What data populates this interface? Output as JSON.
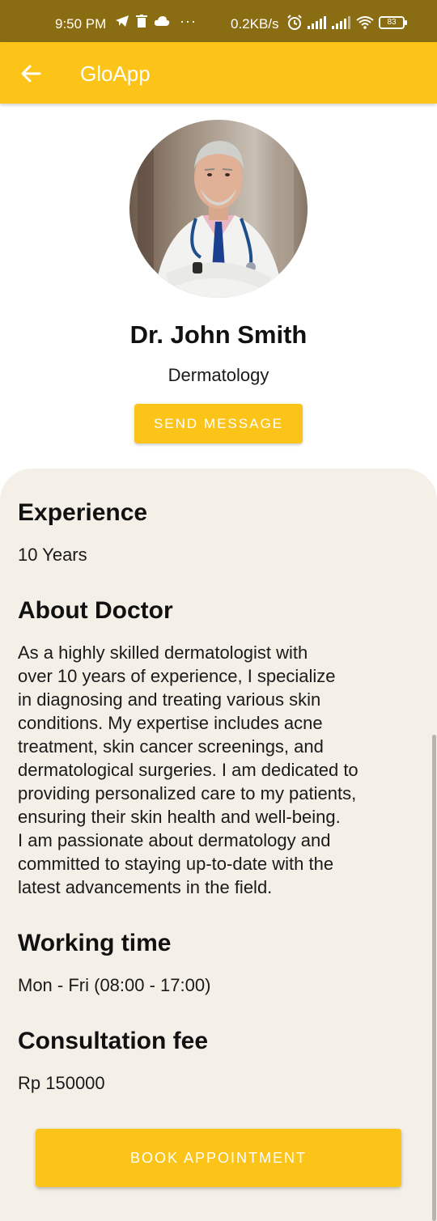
{
  "status_bar": {
    "time": "9:50 PM",
    "dots": "···",
    "net_speed": "0.2KB/s",
    "battery": "83",
    "icons": [
      "telegram-icon",
      "trash-icon",
      "cloud-icon",
      "alarm-icon",
      "signal-icon",
      "signal-icon",
      "wifi-icon",
      "battery-icon"
    ]
  },
  "app_bar": {
    "title": "GloApp",
    "back_icon": "arrow-left-icon"
  },
  "profile": {
    "name": "Dr. John Smith",
    "specialty": "Dermatology",
    "send_message_label": "SEND MESSAGE"
  },
  "sections": {
    "experience": {
      "title": "Experience",
      "value": "10 Years"
    },
    "about": {
      "title": "About Doctor",
      "lines": [
        "As a highly skilled dermatologist with",
        "over 10 years of experience, I specialize",
        "in diagnosing and treating various skin",
        "conditions. My expertise includes acne",
        "treatment, skin cancer screenings, and",
        "dermatological surgeries. I am dedicated to",
        "providing personalized care to my patients,",
        "ensuring their skin health and well-being.",
        "I am passionate about dermatology and",
        "committed to staying up-to-date with the",
        "latest advancements in the field."
      ]
    },
    "working_time": {
      "title": "Working time",
      "value": "Mon - Fri (08:00 - 17:00)"
    },
    "fee": {
      "title": "Consultation fee",
      "value": "Rp 150000"
    }
  },
  "book_label": "BOOK APPOINTMENT",
  "colors": {
    "accent": "#fcc419",
    "status_bar": "#8a6c12",
    "panel": "#f4efe7"
  }
}
